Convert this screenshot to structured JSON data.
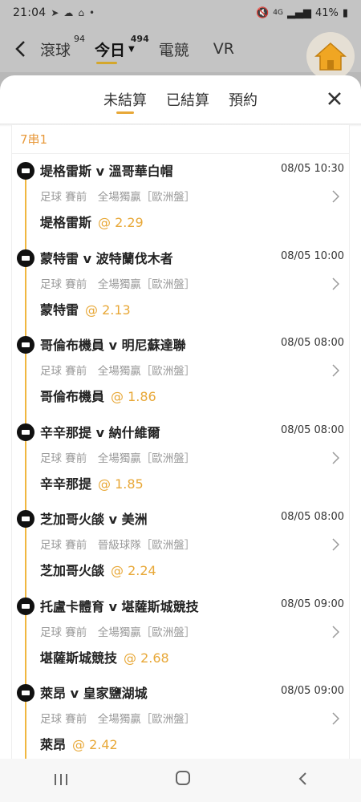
{
  "status": {
    "time": "21:04",
    "network_label": "4G",
    "battery": "41%"
  },
  "topnav": {
    "tabs": [
      {
        "label": "滾球",
        "count": "94"
      },
      {
        "label": "今日",
        "count": "494"
      },
      {
        "label": "電競"
      },
      {
        "label": "VR"
      }
    ],
    "active_index": 1
  },
  "sheet": {
    "tabs": [
      "未結算",
      "已結算",
      "預約"
    ],
    "active_index": 0
  },
  "parlay": {
    "label": "7串1",
    "bets": [
      {
        "match": "堤格雷斯 v 溫哥華白帽",
        "time": "08/05 10:30",
        "meta": "足球 賽前　全場獨贏［歐洲盤］",
        "pick": "堤格雷斯",
        "odds": "@ 2.29"
      },
      {
        "match": "蒙特雷 v 波特蘭伐木者",
        "time": "08/05 10:00",
        "meta": "足球 賽前　全場獨贏［歐洲盤］",
        "pick": "蒙特雷",
        "odds": "@ 2.13"
      },
      {
        "match": "哥倫布機員 v 明尼蘇達聯",
        "time": "08/05 08:00",
        "meta": "足球 賽前　全場獨贏［歐洲盤］",
        "pick": "哥倫布機員",
        "odds": "@ 1.86"
      },
      {
        "match": "辛辛那提 v 納什維爾",
        "time": "08/05 08:00",
        "meta": "足球 賽前　全場獨贏［歐洲盤］",
        "pick": "辛辛那提",
        "odds": "@ 1.85"
      },
      {
        "match": "芝加哥火燄 v 美洲",
        "time": "08/05 08:00",
        "meta": "足球 賽前　晉級球隊［歐洲盤］",
        "pick": "芝加哥火燄",
        "odds": "@ 2.24"
      },
      {
        "match": "托盧卡體育 v 堪薩斯城競技",
        "time": "08/05 09:00",
        "meta": "足球 賽前　全場獨贏［歐洲盤］",
        "pick": "堪薩斯城競技",
        "odds": "@ 2.68"
      },
      {
        "match": "萊昂 v 皇家鹽湖城",
        "time": "08/05 09:00",
        "meta": "足球 賽前　全場獨贏［歐洲盤］",
        "pick": "萊昂",
        "odds": "@ 2.42"
      }
    ]
  },
  "colors": {
    "accent": "#e8a838",
    "parlay_label": "#e89a3c",
    "timeline": "#f0b740"
  }
}
